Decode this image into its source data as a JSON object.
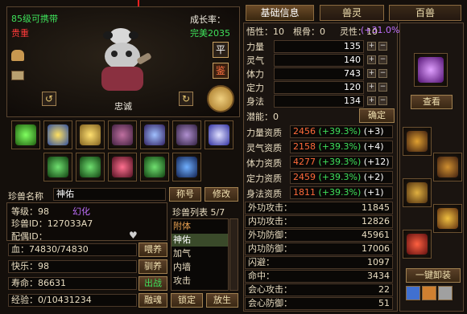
{
  "pet": {
    "level_text": "85级可携带",
    "rarity": "贵重",
    "growth_label": "成长率：",
    "growth_value": "完美2035",
    "personality": "忠诚",
    "name_label": "珍兽名称",
    "name": "神佑",
    "rename_btn": "称号",
    "edit_btn": "修改",
    "level_label": "等级：98",
    "transform": "幻化",
    "id_label": "珍兽ID：127033A7",
    "spouse_label": "配偶ID：",
    "hp_label": "血：74830/74830",
    "happy_label": "快乐：98",
    "life_label": "寿命：86631",
    "exp_label": "经验：0/10431234",
    "feed_btn": "喂养",
    "tame_btn": "驯养",
    "fight_btn": "出战",
    "fuse_btn": "融魂",
    "lock_btn": "锁定",
    "release_btn": "放生",
    "ping_btn": "平",
    "jian_btn": "鉴"
  },
  "list": {
    "header": "珍兽列表 5/7",
    "items": [
      "附体",
      "神佑",
      "加气",
      "内墙",
      "攻击"
    ]
  },
  "tabs": [
    "基础信息",
    "兽灵",
    "百兽"
  ],
  "stats": {
    "wuxing": "悟性：10",
    "gengu": "根骨：0",
    "lingxing": "灵性：10",
    "lingxing_pct": "(+31.0%)",
    "attrs": [
      {
        "label": "力量",
        "value": "135"
      },
      {
        "label": "灵气",
        "value": "140"
      },
      {
        "label": "体力",
        "value": "743"
      },
      {
        "label": "定力",
        "value": "120"
      },
      {
        "label": "身法",
        "value": "134"
      }
    ],
    "potential": "潜能：0",
    "confirm_btn": "确定",
    "quals": [
      {
        "label": "力量资质",
        "base": "2456",
        "bonus": "(+39.3%)",
        "extra": "(+3)"
      },
      {
        "label": "灵气资质",
        "base": "2158",
        "bonus": "(+39.3%)",
        "extra": "(+4)"
      },
      {
        "label": "体力资质",
        "base": "4277",
        "bonus": "(+39.3%)",
        "extra": "(+12)"
      },
      {
        "label": "定力资质",
        "base": "2459",
        "bonus": "(+39.3%)",
        "extra": "(+2)"
      },
      {
        "label": "身法资质",
        "base": "1811",
        "bonus": "(+39.3%)",
        "extra": "(+1)"
      }
    ],
    "combat": [
      {
        "label": "外功攻击：",
        "value": "11845"
      },
      {
        "label": "内功攻击：",
        "value": "12826"
      },
      {
        "label": "外功防御：",
        "value": "45961"
      },
      {
        "label": "内功防御：",
        "value": "17006"
      },
      {
        "label": "闪避：",
        "value": "1097"
      },
      {
        "label": "命中：",
        "value": "3434"
      },
      {
        "label": "会心攻击：",
        "value": "22"
      },
      {
        "label": "会心防御：",
        "value": "51"
      }
    ]
  },
  "equip": {
    "view_btn": "查看",
    "unequip_btn": "一键卸装"
  },
  "colors": {
    "green": "#3ee05a",
    "red": "#ff3a3a",
    "purple": "#c070ff",
    "gold": "#e8c870",
    "orange": "#ff6a3a"
  }
}
